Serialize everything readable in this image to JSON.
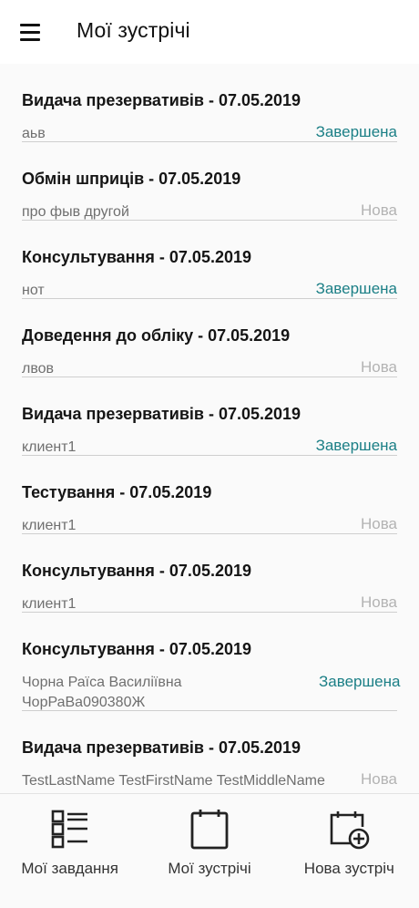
{
  "appbar": {
    "title": "Мої зустрічі",
    "menu_icon": "hamburger-menu-icon"
  },
  "meetings": [
    {
      "title": "Видача презервативів - 07.05.2019",
      "client": "аьв",
      "status": "Завершена",
      "status_color": "#1b7f86"
    },
    {
      "title": "Обмін шприців - 07.05.2019",
      "client": "про фыв другой",
      "status": "Нова",
      "status_color": "#b3b3b3"
    },
    {
      "title": "Консультування - 07.05.2019",
      "client": "нот",
      "status": "Завершена",
      "status_color": "#1b7f86"
    },
    {
      "title": "Доведення до обліку - 07.05.2019",
      "client": "лвов",
      "status": "Нова",
      "status_color": "#b3b3b3"
    },
    {
      "title": "Видача презервативів - 07.05.2019",
      "client": "клиент1",
      "status": "Завершена",
      "status_color": "#1b7f86"
    },
    {
      "title": "Тестування - 07.05.2019",
      "client": "клиент1",
      "status": "Нова",
      "status_color": "#b3b3b3"
    },
    {
      "title": "Консультування - 07.05.2019",
      "client": "клиент1",
      "status": "Нова",
      "status_color": "#b3b3b3"
    },
    {
      "title": "Консультування - 07.05.2019",
      "client": "Чорна Раїса Василіївна ЧорРаВа090380Ж",
      "status": "Завершена",
      "status_color": "#1b7f86"
    },
    {
      "title": "Видача презервативів - 07.05.2019",
      "client": "TestLastName TestFirstName TestMiddleName",
      "status": "Нова",
      "status_color": "#b3b3b3"
    }
  ],
  "bottom_nav": [
    {
      "label": "Мої завдання",
      "icon": "task-list-icon"
    },
    {
      "label": "Мої зустрічі",
      "icon": "calendar-icon"
    },
    {
      "label": "Нова зустріч",
      "icon": "calendar-add-icon"
    }
  ]
}
